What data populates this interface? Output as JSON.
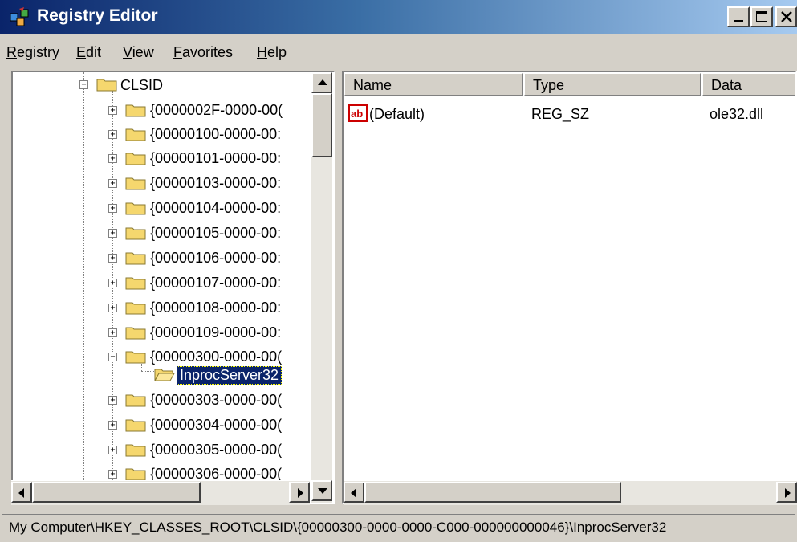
{
  "window": {
    "title": "Registry Editor"
  },
  "menu": [
    {
      "label_u": "R",
      "label_rest": "egistry"
    },
    {
      "label_u": "E",
      "label_rest": "dit"
    },
    {
      "label_u": "V",
      "label_rest": "iew"
    },
    {
      "label_u": "F",
      "label_rest": "avorites"
    },
    {
      "label_u": "H",
      "label_rest": "elp"
    }
  ],
  "tree": {
    "root": "CLSID",
    "items": [
      "{0000002F-0000-00(",
      "{00000100-0000-00:",
      "{00000101-0000-00:",
      "{00000103-0000-00:",
      "{00000104-0000-00:",
      "{00000105-0000-00:",
      "{00000106-0000-00:",
      "{00000107-0000-00:",
      "{00000108-0000-00:",
      "{00000109-0000-00:",
      "{00000300-0000-00(",
      "InprocServer32",
      "{00000303-0000-00(",
      "{00000304-0000-00(",
      "{00000305-0000-00(",
      "{00000306-0000-00("
    ]
  },
  "list": {
    "columns": [
      "Name",
      "Type",
      "Data"
    ],
    "rows": [
      {
        "icon": "string-value-icon",
        "name": "(Default)",
        "type": "REG_SZ",
        "data": "ole32.dll"
      }
    ]
  },
  "status": {
    "path": "My Computer\\HKEY_CLASSES_ROOT\\CLSID\\{00000300-0000-0000-C000-000000000046}\\InprocServer32"
  },
  "colors": {
    "title_start": "#0a246a",
    "title_end": "#a6caf0",
    "chrome": "#d4d0c8",
    "selection": "#0a246a",
    "folder": "#f5d76e"
  }
}
